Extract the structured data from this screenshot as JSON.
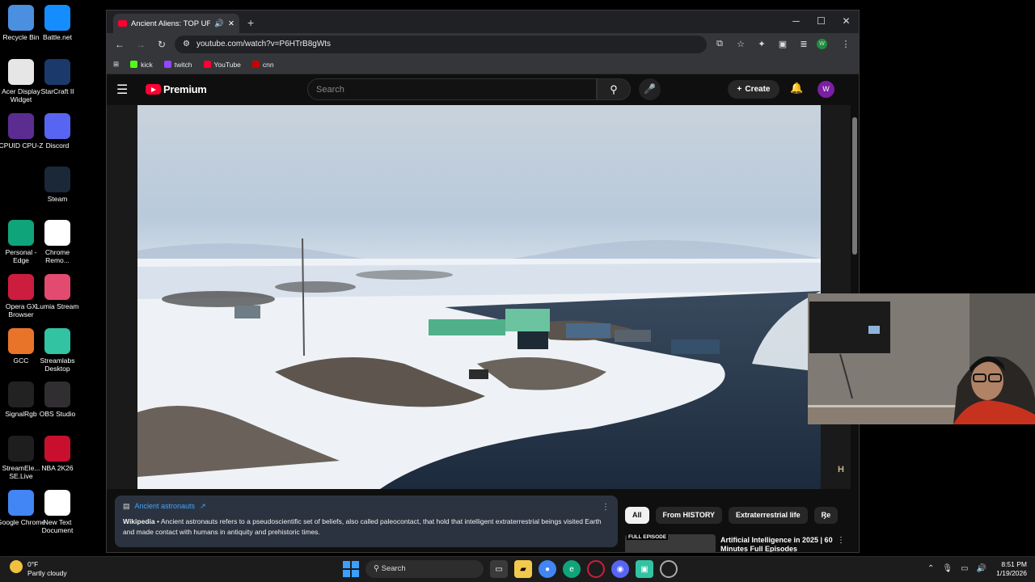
{
  "desktop_icons": [
    {
      "label": "Recycle Bin",
      "icon": "recycle-bin-icon",
      "color": "#4a8fe0"
    },
    {
      "label": "Battle.net",
      "icon": "battlenet-icon",
      "color": "#148eff"
    },
    {
      "label": "Acer Display Widget",
      "icon": "acer-display-icon",
      "color": "#e6e6e6"
    },
    {
      "label": "StarCraft II",
      "icon": "starcraft-icon",
      "color": "#1b3a6b"
    },
    {
      "label": "CPUID CPU-Z",
      "icon": "cpuz-icon",
      "color": "#5b2d91"
    },
    {
      "label": "Discord",
      "icon": "discord-icon",
      "color": "#5865f2"
    },
    {
      "label": "Steam",
      "icon": "steam-icon",
      "color": "#1b2838"
    },
    {
      "label": "Personal - Edge",
      "icon": "edge-icon",
      "color": "#0fa47a"
    },
    {
      "label": "Chrome Remo...",
      "icon": "chrome-remote-icon",
      "color": "#ffffff"
    },
    {
      "label": "Opera GX Browser",
      "icon": "opera-gx-icon",
      "color": "#cc1d3f"
    },
    {
      "label": "Lumia Stream",
      "icon": "lumia-icon",
      "color": "#e34a6f"
    },
    {
      "label": "GCC",
      "icon": "gcc-icon",
      "color": "#e8742a"
    },
    {
      "label": "Streamlabs Desktop",
      "icon": "streamlabs-icon",
      "color": "#31c3a2"
    },
    {
      "label": "SignalRgb",
      "icon": "signalrgb-icon",
      "color": "#222222"
    },
    {
      "label": "OBS Studio",
      "icon": "obs-icon",
      "color": "#302e31"
    },
    {
      "label": "StreamEle... SE.Live",
      "icon": "streamelements-icon",
      "color": "#1e1e1e"
    },
    {
      "label": "NBA 2K26",
      "icon": "nba2k-icon",
      "color": "#c8102e"
    },
    {
      "label": "Google Chrome",
      "icon": "chrome-icon",
      "color": "#4285f4"
    },
    {
      "label": "New Text Document",
      "icon": "text-document-icon",
      "color": "#ffffff"
    }
  ],
  "browser": {
    "tab_title": "Ancient Aliens: TOP UFO M",
    "url": "youtube.com/watch?v=P6HTrB8gWts",
    "bookmarks": [
      {
        "label": "kick",
        "color": "#53fc18"
      },
      {
        "label": "twitch",
        "color": "#9146ff"
      },
      {
        "label": "YouTube",
        "color": "#ff0033"
      },
      {
        "label": "cnn",
        "color": "#cc0000"
      }
    ],
    "profile_initial": "W"
  },
  "youtube": {
    "logo_text": "Premium",
    "search_placeholder": "Search",
    "create_label": "Create",
    "avatar_initial": "W",
    "channel_watermark": "H",
    "wiki": {
      "title": "Ancient astronauts",
      "source": "Wikipedia",
      "text": " • Ancient astronauts refers to a pseudoscientific set of beliefs, also called paleocontact, that hold that intelligent extraterrestrial beings visited Earth and made contact with humans in antiquity and prehistoric times."
    },
    "chips": [
      "All",
      "From HISTORY",
      "Extraterrestrial life",
      "Re"
    ],
    "recommendation": {
      "badge": "FULL EPISODE",
      "title": "Artificial Intelligence in 2025 | 60 Minutes Full Episodes"
    }
  },
  "taskbar": {
    "temperature": "0°F",
    "condition": "Partly cloudy",
    "search_label": "Search",
    "time": "8:51 PM",
    "date": "1/19/2026"
  },
  "colors": {
    "accent": "#ff0033",
    "link": "#3ea6ff",
    "card": "#2c3340"
  }
}
